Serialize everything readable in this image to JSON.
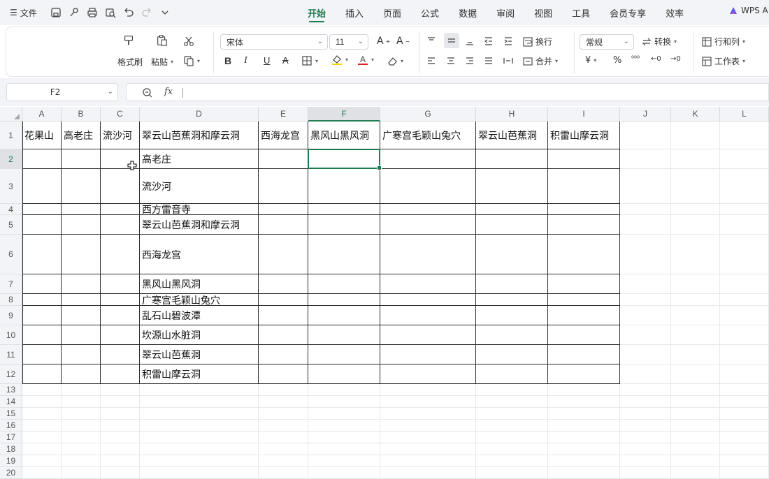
{
  "menu": {
    "file_label": "文件"
  },
  "tabs": [
    "开始",
    "插入",
    "页面",
    "公式",
    "数据",
    "审阅",
    "视图",
    "工具",
    "会员专享",
    "效率"
  ],
  "active_tab": "开始",
  "wps_ai_label": "WPS A",
  "ribbon": {
    "format_painter": "格式刷",
    "paste": "粘贴",
    "font_name": "宋体",
    "font_size": "11",
    "wrap_text": "换行",
    "merge": "合并",
    "number_format": "常规",
    "convert": "转换",
    "rows_cols": "行和列",
    "worksheet": "工作表"
  },
  "formula_bar": {
    "name_box": "F2",
    "fx_label": "fx",
    "formula": ""
  },
  "columns": [
    "A",
    "B",
    "C",
    "D",
    "E",
    "F",
    "G",
    "H",
    "I",
    "J",
    "K",
    "L"
  ],
  "selected_column": "F",
  "rows": [
    "1",
    "2",
    "3",
    "4",
    "5",
    "6",
    "7",
    "8",
    "9",
    "10",
    "11",
    "12",
    "13",
    "14",
    "15",
    "16",
    "17",
    "18",
    "19",
    "20"
  ],
  "selected_row": "2",
  "header_cells": {
    "A1": "花果山",
    "B1": "高老庄",
    "C1": "流沙河",
    "D1": "翠云山芭蕉洞和摩云洞",
    "E1": "西海龙宫",
    "F1": "黑风山黑风洞",
    "G1": "广寒宫毛颖山兔穴",
    "H1": "翠云山芭蕉洞",
    "I1": "积雷山摩云洞"
  },
  "column_d": [
    "高老庄",
    "流沙河",
    "西方雷音寺",
    "翠云山芭蕉洞和摩云洞",
    "西海龙宫",
    "黑风山黑风洞",
    "广寒宫毛颖山兔穴",
    "乱石山碧波潭",
    "坎源山水脏洞",
    "翠云山芭蕉洞",
    "积雷山摩云洞"
  ],
  "colors": {
    "accent": "#1e7b4f",
    "toolbar_bg": "#f3f4f7",
    "grid": "#e7e8eb"
  }
}
